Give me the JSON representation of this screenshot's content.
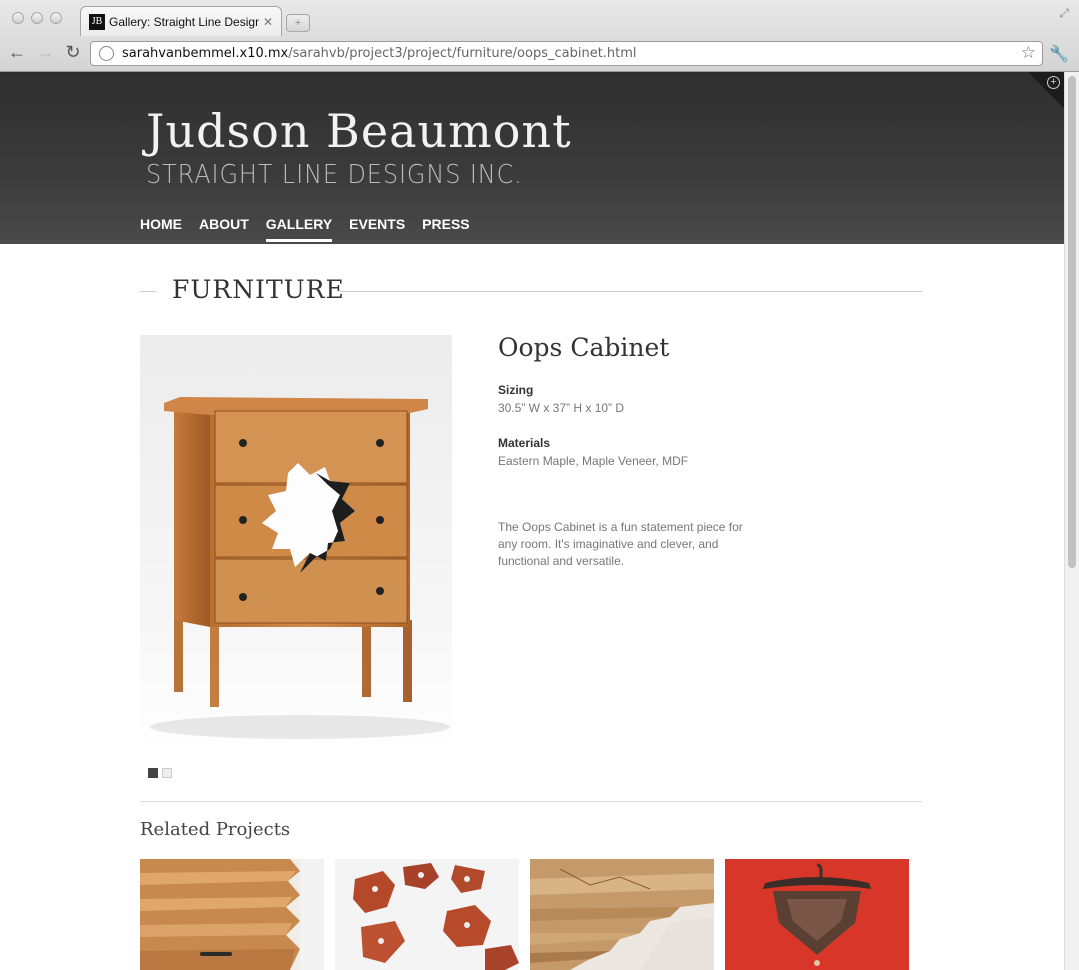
{
  "browser": {
    "tab_title": "Gallery: Straight Line Designs",
    "favicon_text": "JB",
    "url_host": "sarahvanbemmel.x10.mx",
    "url_path": "/sarahvb/project3/project/furniture/oops_cabinet.html"
  },
  "site": {
    "brand_name": "Judson Beaumont",
    "brand_sub": "STRAIGHT LINE DESIGNS INC.",
    "nav": [
      "HOME",
      "ABOUT",
      "GALLERY",
      "EVENTS",
      "PRESS"
    ],
    "active_nav": "GALLERY"
  },
  "section": {
    "title": "FURNITURE"
  },
  "product": {
    "title": "Oops Cabinet",
    "sizing_label": "Sizing",
    "sizing_value": "30.5” W x 37” H x 10” D",
    "materials_label": "Materials",
    "materials_value": "Eastern Maple, Maple Veneer, MDF",
    "description": "The Oops Cabinet is a fun statement piece for any room. It's imaginative and clever, and functional and versatile."
  },
  "slider": {
    "count": 2,
    "active_index": 0
  },
  "related": {
    "title": "Related Projects",
    "items": [
      "folded-wood-dresser",
      "exploding-drawers",
      "layered-wood-table",
      "red-wall-hanger"
    ]
  },
  "colors": {
    "header_bg": "#3a3a3a",
    "wood": "#c57c3c",
    "red": "#d9362a"
  }
}
